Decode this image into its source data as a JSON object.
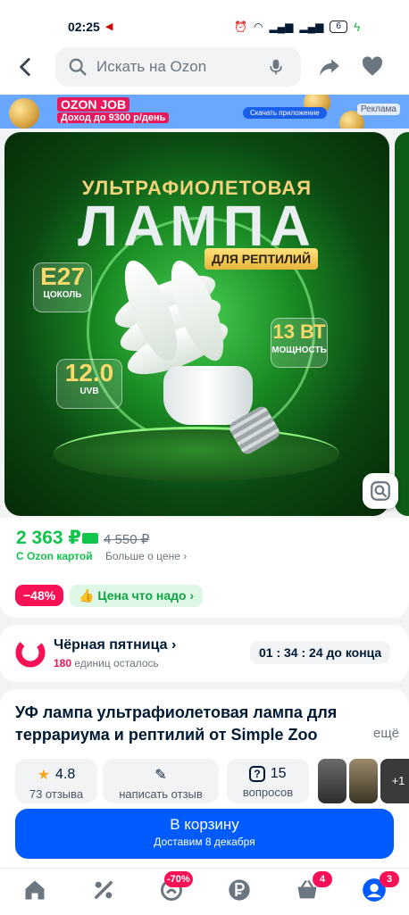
{
  "status_bar": {
    "time": "02:25",
    "battery": "6"
  },
  "search": {
    "placeholder": "Искать на Ozon"
  },
  "banner": {
    "brand": "OZON JOB",
    "slogan": "Доход до 9300 р/день",
    "cta": "Скачать приложение",
    "ad_label": "Реклама"
  },
  "product_image": {
    "headline_top": "УЛЬТРАФИОЛЕТОВАЯ",
    "headline_main": "ЛАМПА",
    "headline_tag": "ДЛЯ РЕПТИЛИЙ",
    "spec1": {
      "value": "E27",
      "label": "ЦОКОЛЬ"
    },
    "spec2": {
      "value": "12.0",
      "label": "UVB"
    },
    "spec3": {
      "value": "13 ВТ",
      "label": "МОЩНОСТЬ"
    }
  },
  "price": {
    "current": "2 363 ₽",
    "old": "4 550 ₽",
    "with_card": "С Ozon картой",
    "more": "Больше о цене ›",
    "discount": "−48%",
    "good_price": "Цена что надо ›"
  },
  "promo": {
    "title": "Чёрная пятница ›",
    "count": "180",
    "remaining": "единиц осталось",
    "timer": "01 : 34 : 24 до конца"
  },
  "product": {
    "title": "УФ лампа ультрафиолетовая лампа для террариума и рептилий от Simple Zoo",
    "more": "ещё",
    "rating": "4.8",
    "reviews": "73 отзыва",
    "write_review": "написать отзыв",
    "questions_count": "15",
    "questions": "вопросов",
    "thumbs_more": "+1"
  },
  "cart": {
    "label": "В корзину",
    "delivery": "Доставим 8 декабря"
  },
  "nav": {
    "sale_badge": "-70%",
    "cart_badge": "4",
    "profile_badge": "3"
  },
  "colors": {
    "accent": "#005bff",
    "green": "#10c44c",
    "pink": "#f91155"
  }
}
